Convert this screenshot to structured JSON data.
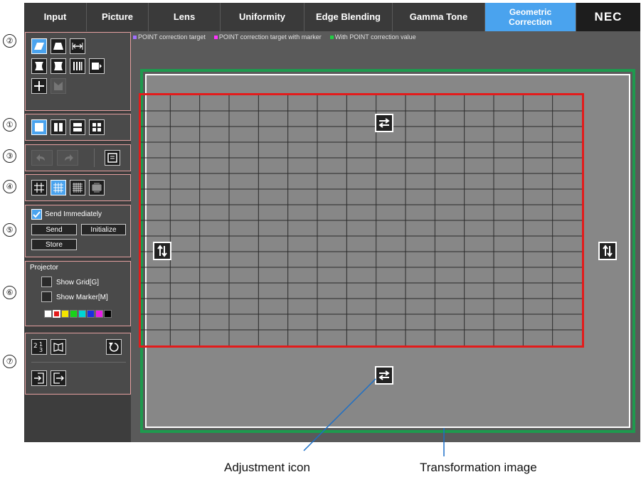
{
  "tabs": [
    {
      "label": "Input"
    },
    {
      "label": "Picture"
    },
    {
      "label": "Lens"
    },
    {
      "label": "Uniformity"
    },
    {
      "label": "Edge Blending"
    },
    {
      "label": "Gamma Tone"
    },
    {
      "label": "Geometric\nCorrection",
      "active": true
    },
    {
      "label": "NEC"
    }
  ],
  "callouts": [
    "②",
    "①",
    "③",
    "④",
    "⑤",
    "⑥",
    "⑦"
  ],
  "send_group": {
    "send_immediately": "Send Immediately",
    "send": "Send",
    "initialize": "Initialize",
    "store": "Store"
  },
  "projector_group": {
    "title": "Projector",
    "show_grid": "Show Grid[G]",
    "show_marker": "Show Marker[M]",
    "colors": [
      "#ffffff",
      "#e31b1b",
      "#f5e600",
      "#19d219",
      "#00d4d4",
      "#1a2fe0",
      "#e61ee6",
      "#000000"
    ]
  },
  "legend": [
    {
      "label": "POINT correction target",
      "color": "#a070ff"
    },
    {
      "label": "POINT correction target with marker",
      "color": "#ff33ff"
    },
    {
      "label": "With POINT correction value",
      "color": "#22cc44"
    }
  ],
  "grid": {
    "columns": 15,
    "rows": 16
  },
  "colors": {
    "accent": "#4aa3ee",
    "grid_border": "#e31b1b",
    "transform_border": "#1e9a4e"
  },
  "captions": {
    "adjustment_icon": "Adjustment icon",
    "transformation_image": "Transformation image"
  }
}
